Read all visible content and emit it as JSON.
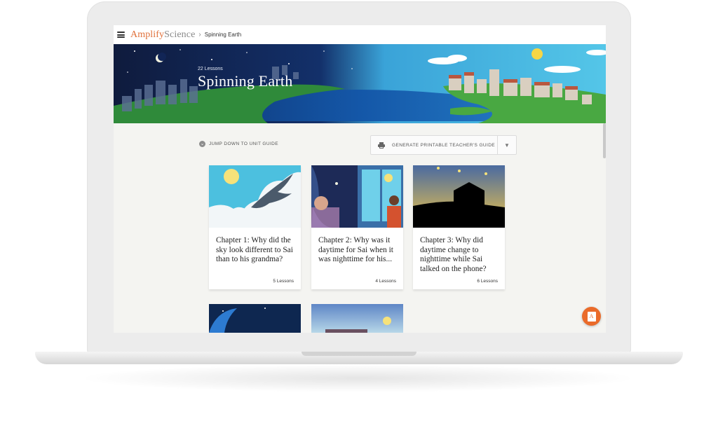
{
  "app": {
    "logo_primary": "Amplify",
    "logo_secondary": "Science",
    "breadcrumb_separator": "›",
    "breadcrumb_current": "Spinning Earth"
  },
  "hero": {
    "lesson_count": "22 Lessons",
    "title": "Spinning Earth"
  },
  "actions": {
    "jump_label": "JUMP DOWN TO UNIT GUIDE",
    "generate_label": "GENERATE PRINTABLE TEACHER'S GUIDE",
    "dropdown_icon": "caret-down-icon",
    "print_icon": "printer-icon"
  },
  "chapters": [
    {
      "title": "Chapter 1: Why did the sky look different to Sai than to his grandma?",
      "lessons": "5 Lessons"
    },
    {
      "title": "Chapter 2: Why was it daytime for Sai when it was nighttime for his...",
      "lessons": "4 Lessons"
    },
    {
      "title": "Chapter 3: Why did daytime change to nighttime while Sai talked on the phone?",
      "lessons": "6 Lessons"
    }
  ],
  "fab": {
    "letter": "A"
  },
  "colors": {
    "brand_orange": "#e0703a",
    "fab_orange": "#ea6b2a"
  }
}
